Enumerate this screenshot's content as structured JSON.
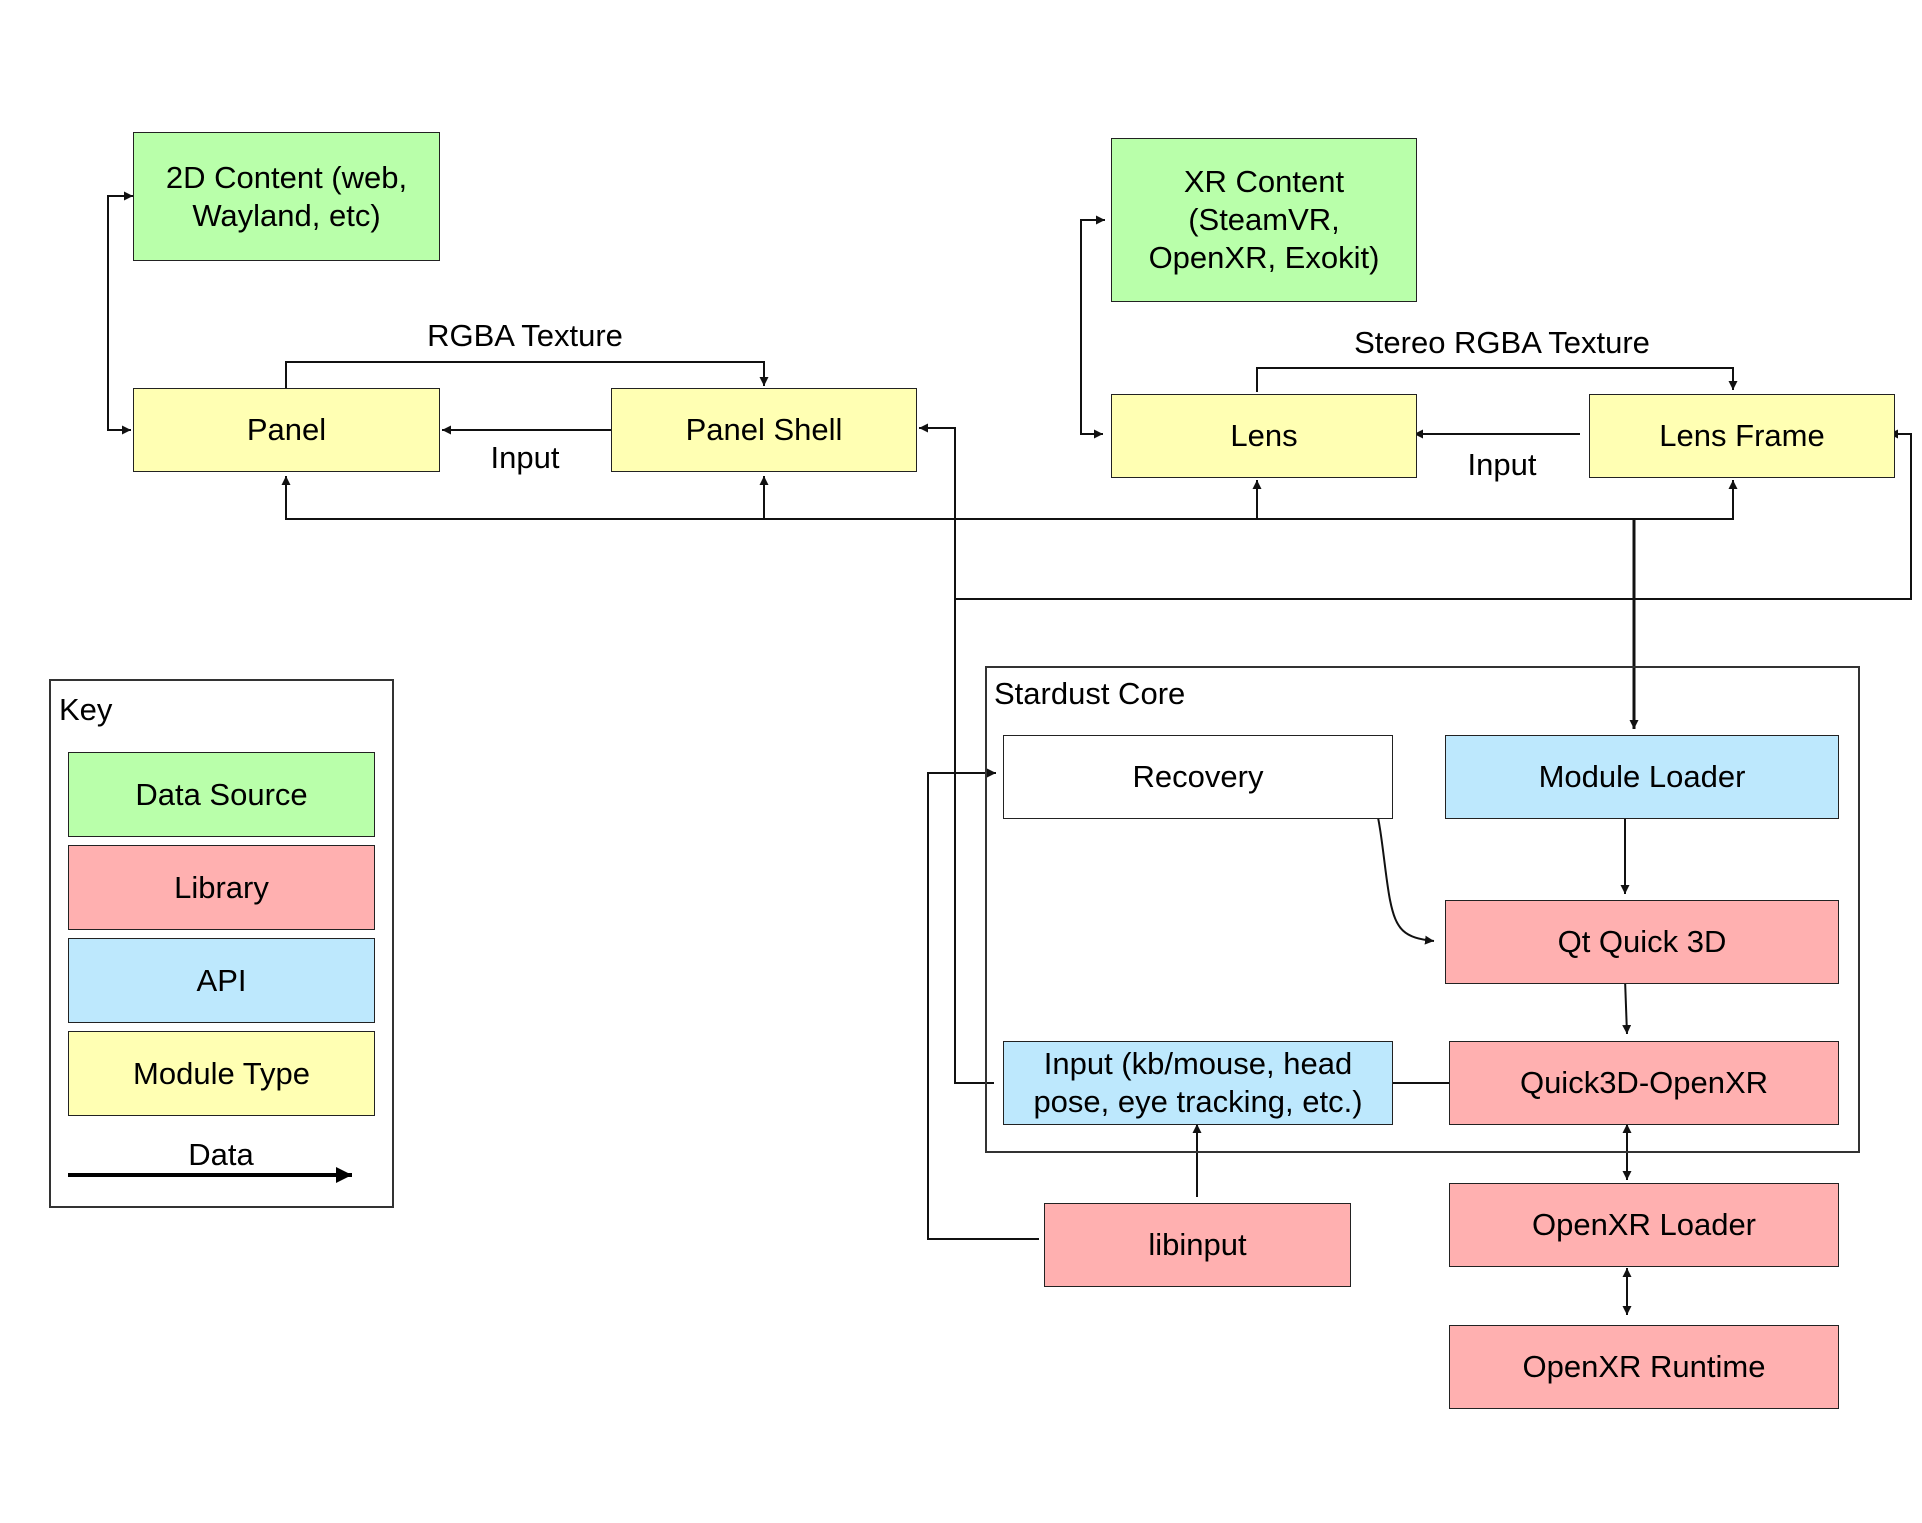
{
  "diagram": {
    "nodes": {
      "content_2d": "2D Content (web, Wayland, etc)",
      "panel": "Panel",
      "panel_shell": "Panel Shell",
      "xr_content": "XR Content (SteamVR, OpenXR, Exokit)",
      "lens": "Lens",
      "lens_frame": "Lens Frame",
      "recovery": "Recovery",
      "module_loader": "Module Loader",
      "qt_quick_3d": "Qt Quick 3D",
      "input": "Input (kb/mouse, head pose, eye tracking, etc.)",
      "quick3d_openxr": "Quick3D-OpenXR",
      "libinput": "libinput",
      "openxr_loader": "OpenXR Loader",
      "openxr_runtime": "OpenXR Runtime"
    },
    "edge_labels": {
      "rgba_texture": "RGBA Texture",
      "panel_input": "Input",
      "stereo_rgba_texture": "Stereo RGBA Texture",
      "lens_input": "Input"
    },
    "core_group_title": "Stardust Core",
    "colors": {
      "data_source": "#b9ffaa",
      "library": "#ffb0b0",
      "api": "#bde8fd",
      "module_type": "#ffffb3"
    }
  },
  "key": {
    "title": "Key",
    "items": [
      {
        "label": "Data Source"
      },
      {
        "label": "Library"
      },
      {
        "label": "API"
      },
      {
        "label": "Module Type"
      }
    ],
    "arrow_label": "Data"
  }
}
